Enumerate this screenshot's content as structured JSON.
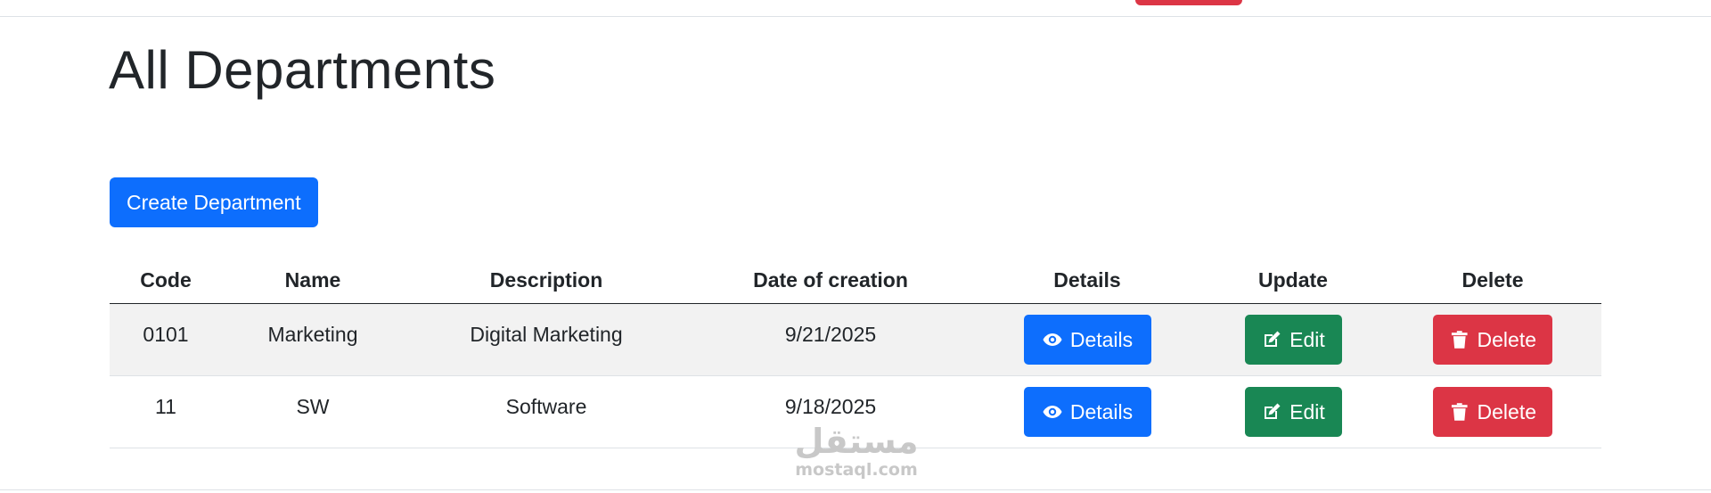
{
  "page": {
    "title": "All Departments"
  },
  "actions": {
    "create_label": "Create Department"
  },
  "table": {
    "headers": [
      "Code",
      "Name",
      "Description",
      "Date of creation",
      "Details",
      "Update",
      "Delete"
    ],
    "rows": [
      {
        "code": "0101",
        "name": "Marketing",
        "description": "Digital Marketing",
        "date": "9/21/2025"
      },
      {
        "code": "11",
        "name": "SW",
        "description": "Software",
        "date": "9/18/2025"
      }
    ],
    "buttons": {
      "details": "Details",
      "edit": "Edit",
      "delete": "Delete"
    }
  },
  "watermark": {
    "arabic": "مستقل",
    "latin": "mostaql.com"
  },
  "icons": {
    "details": "eye-icon",
    "edit": "pencil-square-icon",
    "delete": "trash-icon"
  },
  "colors": {
    "primary": "#0d6efd",
    "success": "#198754",
    "danger": "#dc3545",
    "stripe": "#f2f2f2"
  }
}
